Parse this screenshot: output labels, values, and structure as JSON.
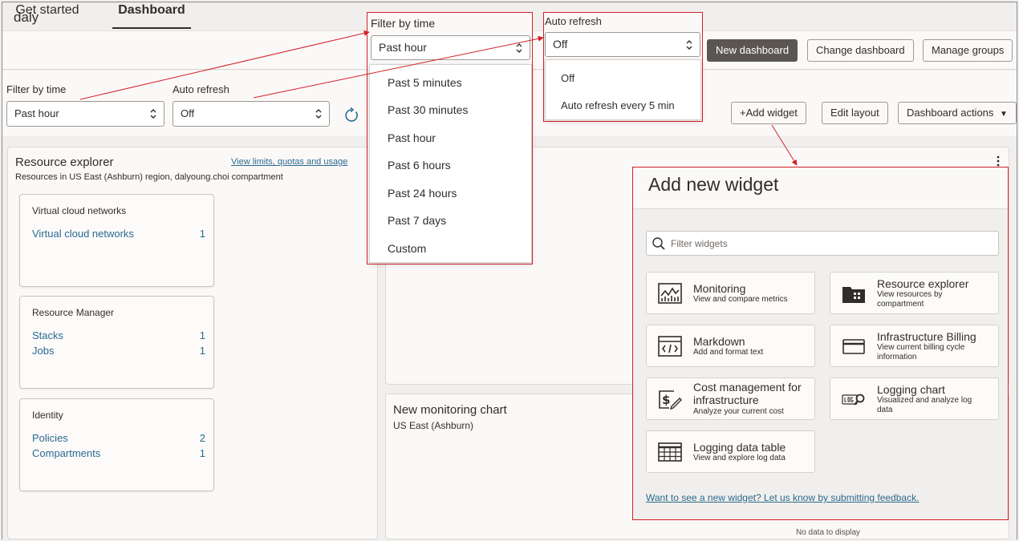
{
  "tabs": [
    {
      "label": "Get started",
      "active": false
    },
    {
      "label": "Dashboard",
      "active": true
    }
  ],
  "header": {
    "dashboard_name": "daly",
    "new_dashboard": "New dashboard",
    "change_dashboard": "Change dashboard",
    "manage_groups": "Manage groups"
  },
  "filters": {
    "time_label": "Filter by time",
    "time_value": "Past hour",
    "refresh_label": "Auto refresh",
    "refresh_value": "Off"
  },
  "toolbar": {
    "add_widget": "Add widget",
    "edit_layout": "Edit layout",
    "dashboard_actions": "Dashboard actions"
  },
  "resource_explorer": {
    "title": "Resource explorer",
    "subtitle": "Resources in US East (Ashburn) region, dalyoung.choi compartment",
    "link": "View limits, quotas and usage",
    "groups": [
      {
        "title": "Virtual cloud networks",
        "rows": [
          {
            "label": "Virtual cloud networks",
            "count": "1"
          }
        ]
      },
      {
        "title": "Resource Manager",
        "rows": [
          {
            "label": "Stacks",
            "count": "1"
          },
          {
            "label": "Jobs",
            "count": "1"
          }
        ]
      },
      {
        "title": "Identity",
        "rows": [
          {
            "label": "Policies",
            "count": "2"
          },
          {
            "label": "Compartments",
            "count": "1"
          }
        ]
      }
    ]
  },
  "monitoring_chart": {
    "title": "New monitoring chart",
    "subtitle": "US East (Ashburn)",
    "empty": "No data to display"
  },
  "time_dropdown": {
    "label": "Filter by time",
    "value": "Past hour",
    "options": [
      "Past 5 minutes",
      "Past 30 minutes",
      "Past hour",
      "Past 6 hours",
      "Past 24 hours",
      "Past 7 days",
      "Custom"
    ]
  },
  "refresh_dropdown": {
    "label": "Auto refresh",
    "value": "Off",
    "options": [
      "Off",
      "Auto refresh every 5 min"
    ]
  },
  "add_widget_panel": {
    "title": "Add new widget",
    "search_placeholder": "Filter widgets",
    "widgets": [
      {
        "title": "Monitoring",
        "desc": "View and compare metrics",
        "icon": "monitoring-chart-icon"
      },
      {
        "title": "Resource explorer",
        "desc": "View resources by compartment",
        "icon": "folder-icon"
      },
      {
        "title": "Markdown",
        "desc": "Add and format text",
        "icon": "code-window-icon"
      },
      {
        "title": "Infrastructure Billing",
        "desc": "View current billing cycle information",
        "icon": "credit-card-icon"
      },
      {
        "title": "Cost management for infrastructure",
        "desc": "Analyze your current cost",
        "icon": "cost-edit-icon"
      },
      {
        "title": "Logging chart",
        "desc": "Visualized and analyze log data",
        "icon": "logs-search-icon"
      },
      {
        "title": "Logging data table",
        "desc": "View and explore log data",
        "icon": "table-icon"
      }
    ],
    "feedback": "Want to see a new widget? Let us know by submitting feedback."
  }
}
